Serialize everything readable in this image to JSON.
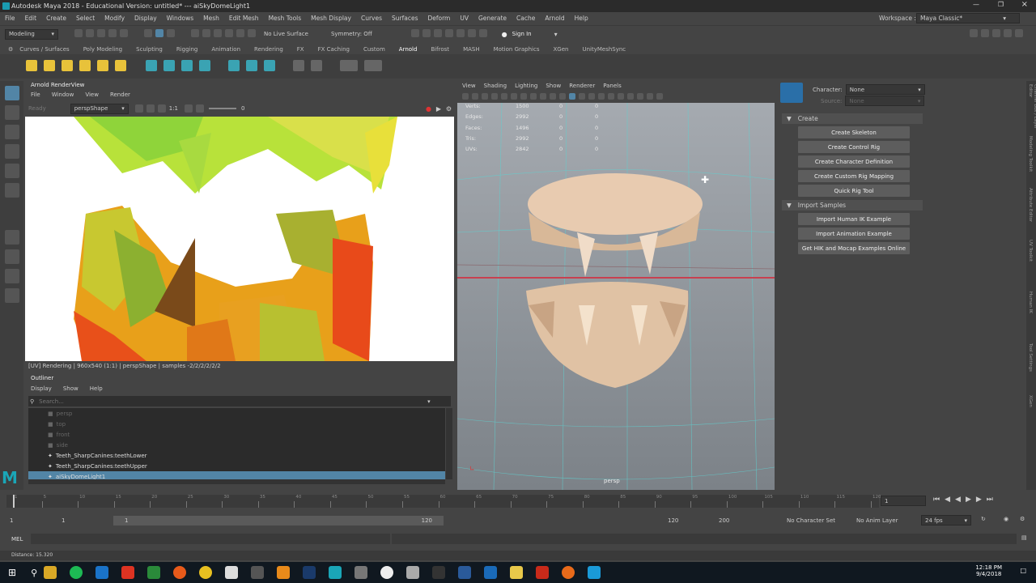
{
  "titlebar": {
    "title": "Autodesk Maya 2018 - Educational Version: untitled*   ---   aiSkyDomeLight1"
  },
  "menubar": {
    "items": [
      "File",
      "Edit",
      "Create",
      "Select",
      "Modify",
      "Display",
      "Windows",
      "Mesh",
      "Edit Mesh",
      "Mesh Tools",
      "Mesh Display",
      "Curves",
      "Surfaces",
      "Deform",
      "UV",
      "Generate",
      "Cache",
      "Arnold",
      "Help"
    ],
    "workspace_label": "Workspace :",
    "workspace_value": "Maya Classic*"
  },
  "statusline": {
    "mode": "Modeling",
    "live_surface": "No Live Surface",
    "symmetry": "Symmetry: Off",
    "sign_in": "Sign In"
  },
  "shelf": {
    "tabs": [
      "Curves / Surfaces",
      "Poly Modeling",
      "Sculpting",
      "Rigging",
      "Animation",
      "Rendering",
      "FX",
      "FX Caching",
      "Custom",
      "Arnold",
      "Bifrost",
      "MASH",
      "Motion Graphics",
      "XGen",
      "UnityMeshSync"
    ],
    "active": "Arnold"
  },
  "renderview": {
    "title": "Arnold RenderView",
    "menu": [
      "File",
      "Window",
      "View",
      "Render"
    ],
    "state": "Ready",
    "camera": "perspShape",
    "ratio": "1:1",
    "exposure": "0",
    "status": "[UV] Rendering | 960x540 (1:1) | perspShape | samples -2/2/2/2/2/2"
  },
  "outliner": {
    "title": "Outliner",
    "menu": [
      "Display",
      "Show",
      "Help"
    ],
    "search_placeholder": "Search...",
    "items": [
      "persp",
      "top",
      "front",
      "side",
      "Teeth_SharpCanines:teethLower",
      "Teeth_SharpCanines:teethUpper",
      "aiSkyDomeLight1"
    ]
  },
  "viewport": {
    "menu": [
      "View",
      "Shading",
      "Lighting",
      "Show",
      "Renderer",
      "Panels"
    ],
    "hud": [
      {
        "label": "Verts:",
        "v1": "1500",
        "v2": "0",
        "v3": "0"
      },
      {
        "label": "Edges:",
        "v1": "2992",
        "v2": "0",
        "v3": "0"
      },
      {
        "label": "Faces:",
        "v1": "1496",
        "v2": "0",
        "v3": "0"
      },
      {
        "label": "Tris:",
        "v1": "2992",
        "v2": "0",
        "v3": "0"
      },
      {
        "label": "UVs:",
        "v1": "2842",
        "v2": "0",
        "v3": "0"
      }
    ],
    "camera_label": "persp"
  },
  "humanik": {
    "character_label": "Character:",
    "character_value": "None",
    "source_label": "Source:",
    "source_value": "None",
    "create_section": "Create",
    "create_buttons": [
      "Create Skeleton",
      "Create Control Rig",
      "Create Character Definition",
      "Create Custom Rig Mapping",
      "Quick Rig Tool"
    ],
    "import_section": "Import Samples",
    "import_buttons": [
      "Import Human IK Example",
      "Import Animation Example",
      "Get HIK and Mocap Examples Online"
    ]
  },
  "sidetabs": [
    "Channel Box / Layer Editor",
    "Modeling Toolkit",
    "Attribute Editor",
    "UV Toolkit",
    "Human IK",
    "Tool Settings",
    "XGen"
  ],
  "timeline": {
    "ticks": [
      "1",
      "5",
      "10",
      "15",
      "20",
      "25",
      "30",
      "35",
      "40",
      "45",
      "50",
      "55",
      "60",
      "65",
      "70",
      "75",
      "80",
      "85",
      "90",
      "95",
      "100",
      "105",
      "110",
      "115",
      "120"
    ],
    "current_frame": "1"
  },
  "range": {
    "start": "1",
    "start2": "1",
    "bar_start": "1",
    "bar_end": "120",
    "end": "120",
    "end2": "200",
    "char_set": "No Character Set",
    "anim_layer": "No Anim Layer",
    "fps": "24 fps"
  },
  "cmd": {
    "label": "MEL"
  },
  "help": {
    "text": "Distance:           15.320"
  },
  "taskbar": {
    "time": "12:18 PM",
    "date": "9/4/2018"
  },
  "colors": {
    "accent": "#5285a6",
    "bg": "#444444"
  }
}
